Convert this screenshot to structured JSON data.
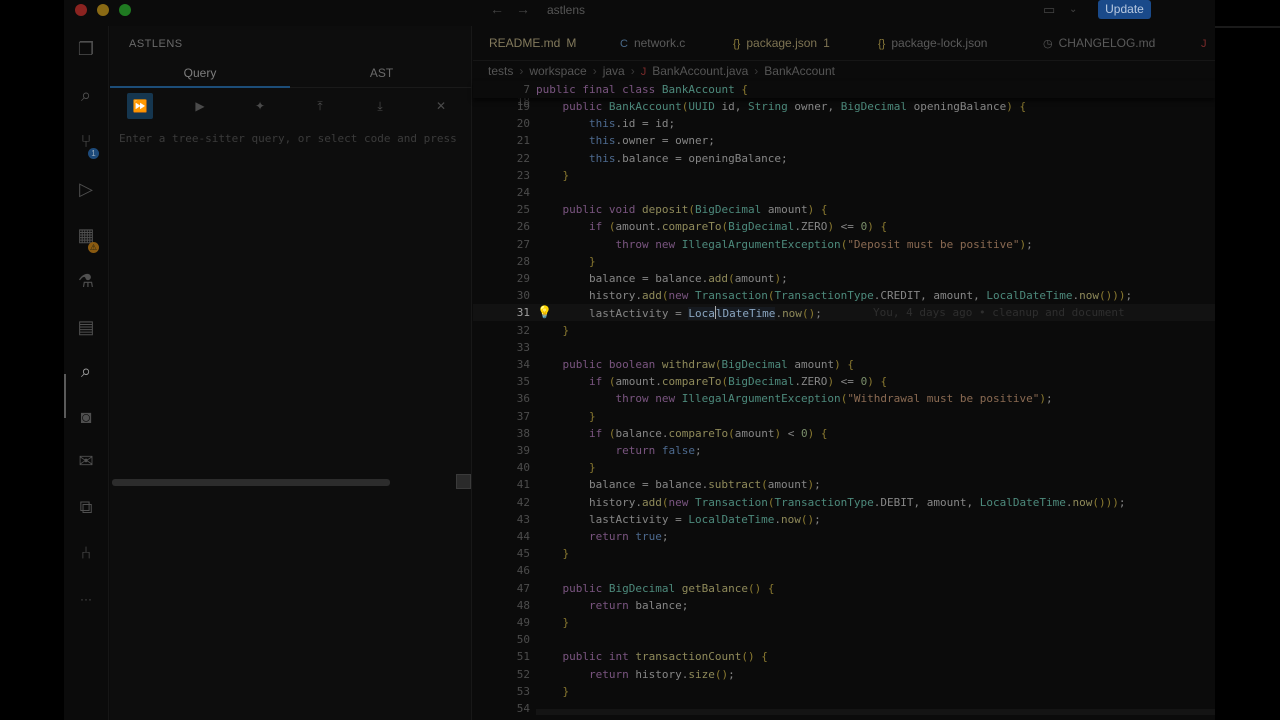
{
  "window": {
    "title": "astlens",
    "update_label": "Update"
  },
  "activity_bar": {
    "items": [
      {
        "name": "explorer-icon",
        "glyph": "❐"
      },
      {
        "name": "search-icon",
        "glyph": "⌕"
      },
      {
        "name": "source-control-icon",
        "glyph": "⑂",
        "badge": "1"
      },
      {
        "name": "run-debug-icon",
        "glyph": "▷"
      },
      {
        "name": "extensions-icon",
        "glyph": "▦",
        "badge": "⚠"
      },
      {
        "name": "testing-icon",
        "glyph": "⚗"
      },
      {
        "name": "remote-explorer-icon",
        "glyph": "▤"
      },
      {
        "name": "astlens-icon",
        "glyph": "⌕"
      },
      {
        "name": "copilot-icon",
        "glyph": "◙"
      },
      {
        "name": "chat-icon",
        "glyph": "✉"
      },
      {
        "name": "python-icon",
        "glyph": "⧉"
      },
      {
        "name": "git-graph-icon",
        "glyph": "⑃"
      },
      {
        "name": "more-icon",
        "glyph": "···"
      }
    ]
  },
  "side_panel": {
    "title": "ASTLENS",
    "tabs": [
      "Query",
      "AST"
    ],
    "active_tab": "Query",
    "toolbar": {
      "run_all": "⏩",
      "run": "▶",
      "sparkle": "✦",
      "upload": "⤒",
      "download": "⤓",
      "close": "✕"
    },
    "query_placeholder": "Enter a tree-sitter query, or select code and press"
  },
  "editor_tabs": [
    {
      "label": "README.md",
      "icon": "",
      "suffix": "M"
    },
    {
      "label": "network.c",
      "icon": "C",
      "suffix": ""
    },
    {
      "label": "package.json",
      "icon": "{}",
      "suffix": "1"
    },
    {
      "label": "package-lock.json",
      "icon": "{}",
      "suffix": ""
    },
    {
      "label": "CHANGELOG.md",
      "icon": "◷",
      "suffix": ""
    },
    {
      "label": "",
      "icon": "J",
      "suffix": ""
    }
  ],
  "breadcrumbs": [
    "tests",
    "workspace",
    "java",
    "BankAccount.java",
    "BankAccount"
  ],
  "editor": {
    "sticky_line": "7",
    "sticky_code": "public final class BankAccount {",
    "first_partial_line": "18",
    "last_partial_line": "54",
    "lines": [
      {
        "n": "19",
        "code": "    public BankAccount(UUID id, String owner, BigDecimal openingBalance) {"
      },
      {
        "n": "20",
        "code": "        this.id = id;"
      },
      {
        "n": "21",
        "code": "        this.owner = owner;"
      },
      {
        "n": "22",
        "code": "        this.balance = openingBalance;"
      },
      {
        "n": "23",
        "code": "    }"
      },
      {
        "n": "24",
        "code": ""
      },
      {
        "n": "25",
        "code": "    public void deposit(BigDecimal amount) {"
      },
      {
        "n": "26",
        "code": "        if (amount.compareTo(BigDecimal.ZERO) <= 0) {"
      },
      {
        "n": "27",
        "code": "            throw new IllegalArgumentException(\"Deposit must be positive\");"
      },
      {
        "n": "28",
        "code": "        }"
      },
      {
        "n": "29",
        "code": "        balance = balance.add(amount);"
      },
      {
        "n": "30",
        "code": "        history.add(new Transaction(TransactionType.CREDIT, amount, LocalDateTime.now()));"
      },
      {
        "n": "31",
        "code": "        lastActivity = LocalDateTime.now();"
      },
      {
        "n": "32",
        "code": "    }"
      },
      {
        "n": "33",
        "code": ""
      },
      {
        "n": "34",
        "code": "    public boolean withdraw(BigDecimal amount) {"
      },
      {
        "n": "35",
        "code": "        if (amount.compareTo(BigDecimal.ZERO) <= 0) {"
      },
      {
        "n": "36",
        "code": "            throw new IllegalArgumentException(\"Withdrawal must be positive\");"
      },
      {
        "n": "37",
        "code": "        }"
      },
      {
        "n": "38",
        "code": "        if (balance.compareTo(amount) < 0) {"
      },
      {
        "n": "39",
        "code": "            return false;"
      },
      {
        "n": "40",
        "code": "        }"
      },
      {
        "n": "41",
        "code": "        balance = balance.subtract(amount);"
      },
      {
        "n": "42",
        "code": "        history.add(new Transaction(TransactionType.DEBIT, amount, LocalDateTime.now()));"
      },
      {
        "n": "43",
        "code": "        lastActivity = LocalDateTime.now();"
      },
      {
        "n": "44",
        "code": "        return true;"
      },
      {
        "n": "45",
        "code": "    }"
      },
      {
        "n": "46",
        "code": ""
      },
      {
        "n": "47",
        "code": "    public BigDecimal getBalance() {"
      },
      {
        "n": "48",
        "code": "        return balance;"
      },
      {
        "n": "49",
        "code": "    }"
      },
      {
        "n": "50",
        "code": ""
      },
      {
        "n": "51",
        "code": "    public int transactionCount() {"
      },
      {
        "n": "52",
        "code": "        return history.size();"
      },
      {
        "n": "53",
        "code": "    }"
      }
    ],
    "current_line": "31",
    "blame": "You, 4 days ago • cleanup and document"
  }
}
